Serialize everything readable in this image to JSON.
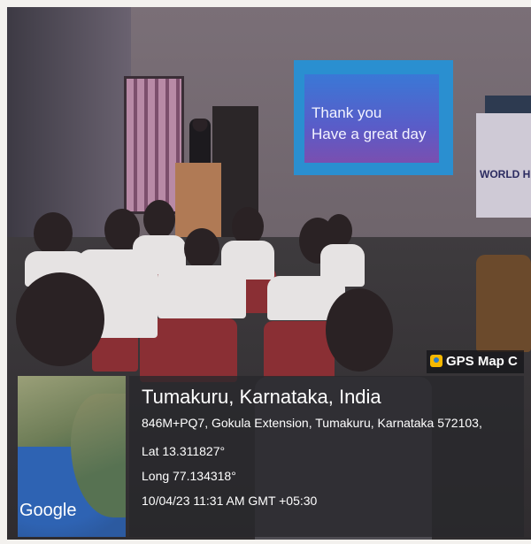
{
  "slide": {
    "line1": "Thank you",
    "line2": "Have a great day"
  },
  "gps_overlay": {
    "brand": "GPS Map C",
    "place": "Tumakuru, Karnataka, India",
    "address": "846M+PQ7, Gokula Extension, Tumakuru, Karnataka 572103,",
    "lat": "Lat 13.311827°",
    "long": "Long 77.134318°",
    "timestamp": "10/04/23 11:31 AM GMT +05:30",
    "map_label": "Google"
  },
  "banner": {
    "text": "WORLD HE"
  }
}
